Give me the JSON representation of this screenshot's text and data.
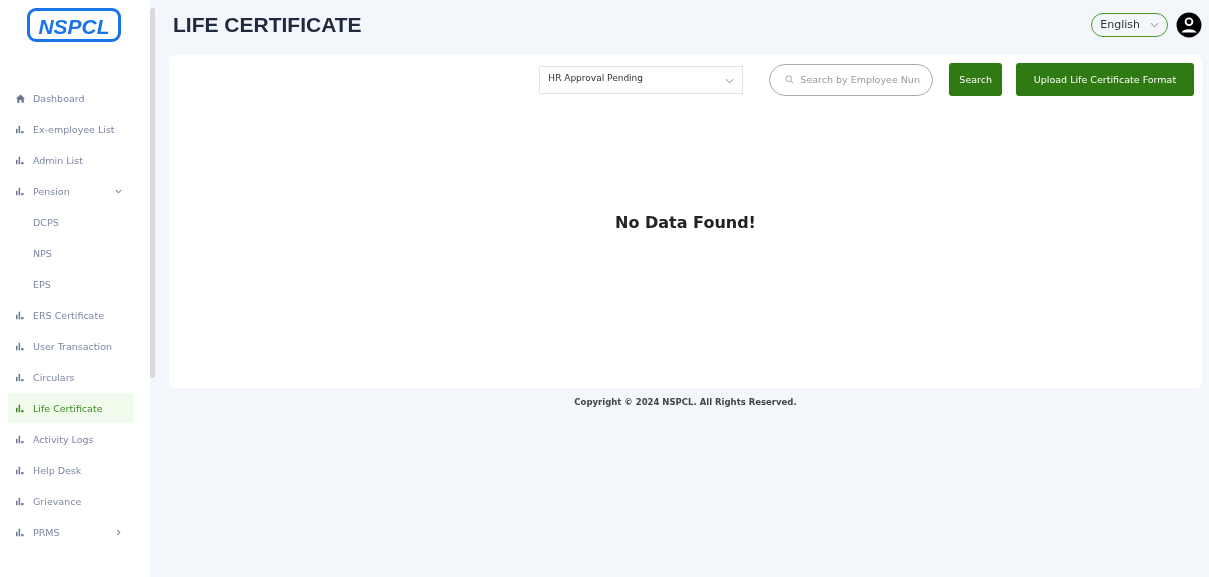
{
  "logo": {
    "text": "NSPCL"
  },
  "sidebar": {
    "items": [
      {
        "kind": "home",
        "label": "Dashboard",
        "selected": false
      },
      {
        "kind": "chart",
        "label": "Ex-employee List",
        "selected": false
      },
      {
        "kind": "chart",
        "label": "Admin List",
        "selected": false
      },
      {
        "kind": "chart",
        "label": "Pension",
        "selected": false,
        "expanded": true,
        "children": [
          {
            "kind": "sub",
            "label": "DCPS",
            "selected": false
          },
          {
            "kind": "sub",
            "label": "NPS",
            "selected": false
          },
          {
            "kind": "sub",
            "label": "EPS",
            "selected": false
          }
        ]
      },
      {
        "kind": "chart",
        "label": "ERS Certificate",
        "selected": false
      },
      {
        "kind": "chart",
        "label": "User Transaction",
        "selected": false
      },
      {
        "kind": "chart",
        "label": "Circulars",
        "selected": false
      },
      {
        "kind": "chart",
        "label": "Life Certificate",
        "selected": true
      },
      {
        "kind": "chart",
        "label": "Activity Logs",
        "selected": false
      },
      {
        "kind": "chart",
        "label": "Help Desk",
        "selected": false
      },
      {
        "kind": "chart",
        "label": "Grievance",
        "selected": false
      },
      {
        "kind": "chart",
        "label": "PRMS",
        "selected": false,
        "expanded": false
      }
    ]
  },
  "header": {
    "title": "LIFE CERTIFICATE",
    "language": "English"
  },
  "toolbar": {
    "status_filter": "HR Approval Pending",
    "search": {
      "placeholder": "Search by Employee Nun"
    },
    "search_button": "Search",
    "upload_button": "Upload Life Certificate Format"
  },
  "empty_message": "No Data Found!",
  "footer": "Copyright © 2024 NSPCL. All Rights Reserved."
}
